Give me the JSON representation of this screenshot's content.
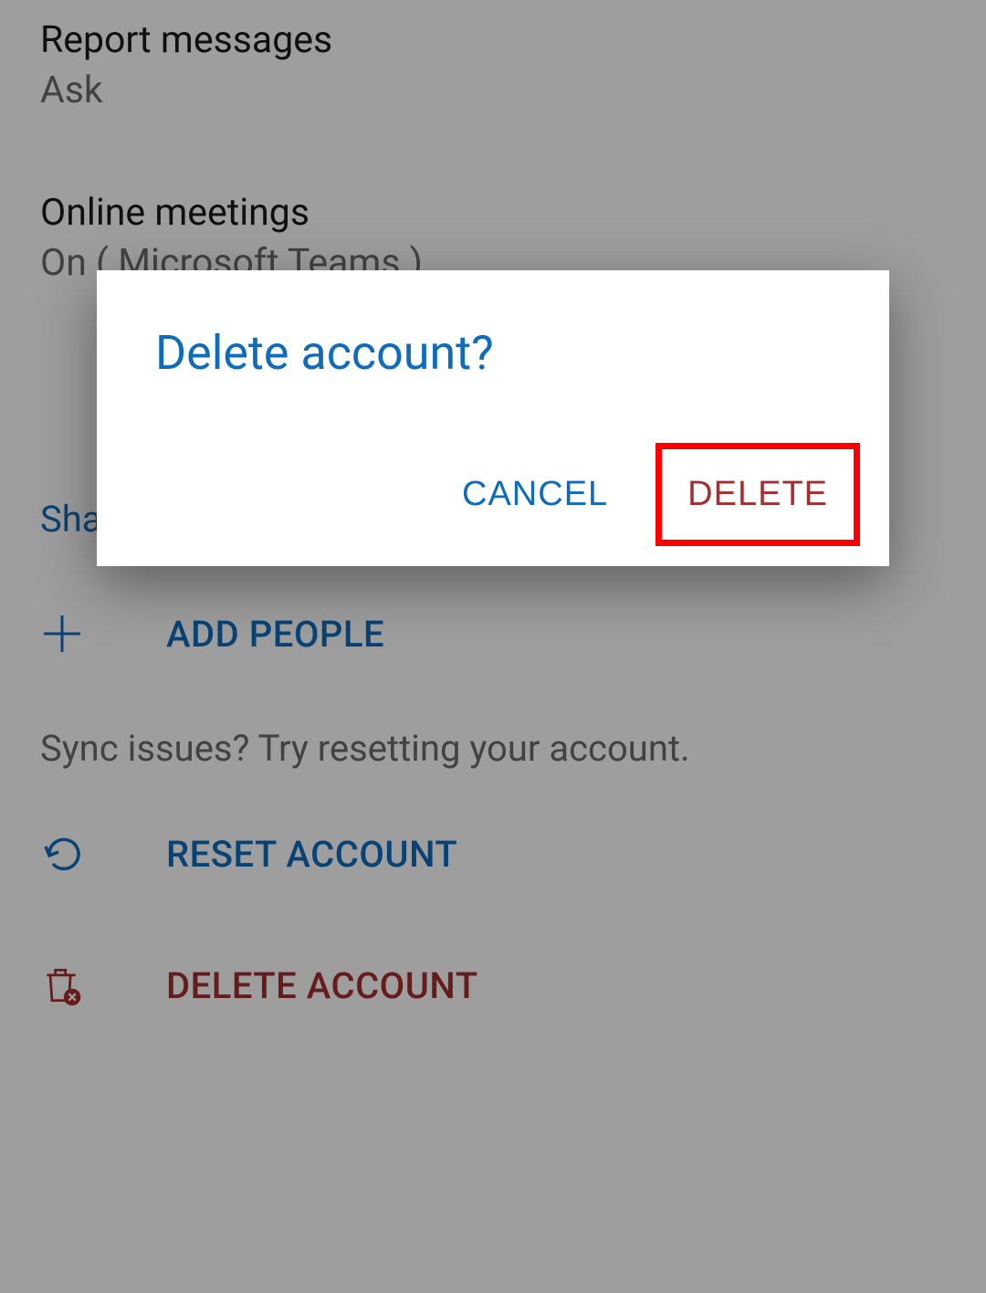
{
  "settings": {
    "report_messages": {
      "title": "Report messages",
      "value": "Ask"
    },
    "online_meetings": {
      "title": "Online meetings",
      "value": "On ( Microsoft Teams )"
    }
  },
  "share_section_label": "Share your Inbox",
  "actions": {
    "add_people": "ADD PEOPLE",
    "reset_account": "RESET ACCOUNT",
    "delete_account": "DELETE ACCOUNT"
  },
  "help_text": "Sync issues? Try resetting your account.",
  "dialog": {
    "title": "Delete account?",
    "cancel": "CANCEL",
    "delete": "DELETE"
  },
  "colors": {
    "accent": "#0f6cbd",
    "danger": "#a62e2e"
  }
}
